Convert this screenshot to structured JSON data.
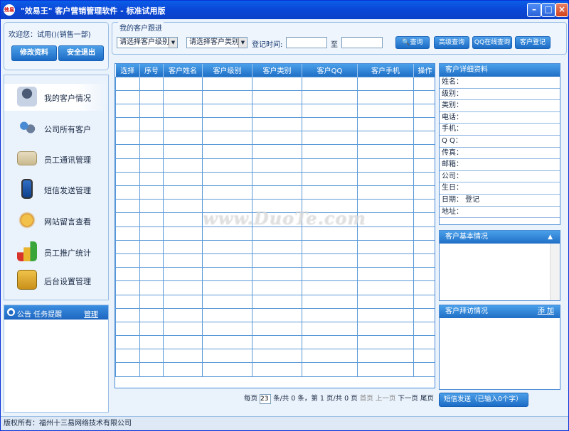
{
  "window": {
    "icon_text": "效易",
    "title": "\"效易王\" 客户营销管理软件  - 标准试用版",
    "minimize": "–",
    "maximize": "□",
    "close": "×"
  },
  "user_panel": {
    "welcome": "欢迎您：试用()(销售一部)",
    "edit_profile": "修改资料",
    "logout": "安全退出"
  },
  "nav": {
    "items": [
      {
        "label": "我的客户情况",
        "icon": "user-icon"
      },
      {
        "label": "公司所有客户",
        "icon": "users-icon"
      },
      {
        "label": "员工通讯管理",
        "icon": "contact-card-icon"
      },
      {
        "label": "短信发送管理",
        "icon": "phone-icon"
      },
      {
        "label": "网站留言查看",
        "icon": "message-icon"
      },
      {
        "label": "员工推广统计",
        "icon": "bar-chart-icon"
      },
      {
        "label": "后台设置管理",
        "icon": "settings-icon"
      }
    ]
  },
  "notice": {
    "title": "公告 任务提醒",
    "manage": "管理"
  },
  "search": {
    "frame_title": "我的客户跟进",
    "level_select": "请选择客户级别",
    "type_select": "请选择客户类别",
    "reg_time_label": "登记时间:",
    "to_label": "至",
    "btn_query": "查询",
    "btn_advanced": "高级查询",
    "btn_qq": "QQ在线查询",
    "btn_register": "客户登记"
  },
  "table": {
    "columns": [
      "选择",
      "序号",
      "客户姓名",
      "客户级别",
      "客户类别",
      "客户QQ",
      "客户手机",
      "操作"
    ],
    "empty_rows": 22
  },
  "pager": {
    "per_page": "每页",
    "per_page_value": "23",
    "summary": "条/共 0 条，第 1 页/共 0 页",
    "first": "首页",
    "prev": "上一页",
    "next": "下一页",
    "last": "尾页"
  },
  "detail": {
    "title": "客户详细资料",
    "fields": [
      "姓名：",
      "级别：",
      "类别：",
      "电话：",
      "手机：",
      "Q Q：",
      "传真：",
      "邮箱：",
      "公司：",
      "生日：",
      "日期： 登记",
      "地址："
    ]
  },
  "basic_info": {
    "title": "客户基本情况"
  },
  "visit": {
    "title": "客户拜访情况",
    "add": "添 加"
  },
  "sms_button": "短信发送（已输入0个字）",
  "footer": "版权所有：福州十三易网络技术有限公司",
  "watermark": "www.DuoTe.com",
  "colors": {
    "titlebar": "#0b48d8",
    "accent": "#1f6fc6",
    "panel_bg": "#eaf2fb"
  }
}
